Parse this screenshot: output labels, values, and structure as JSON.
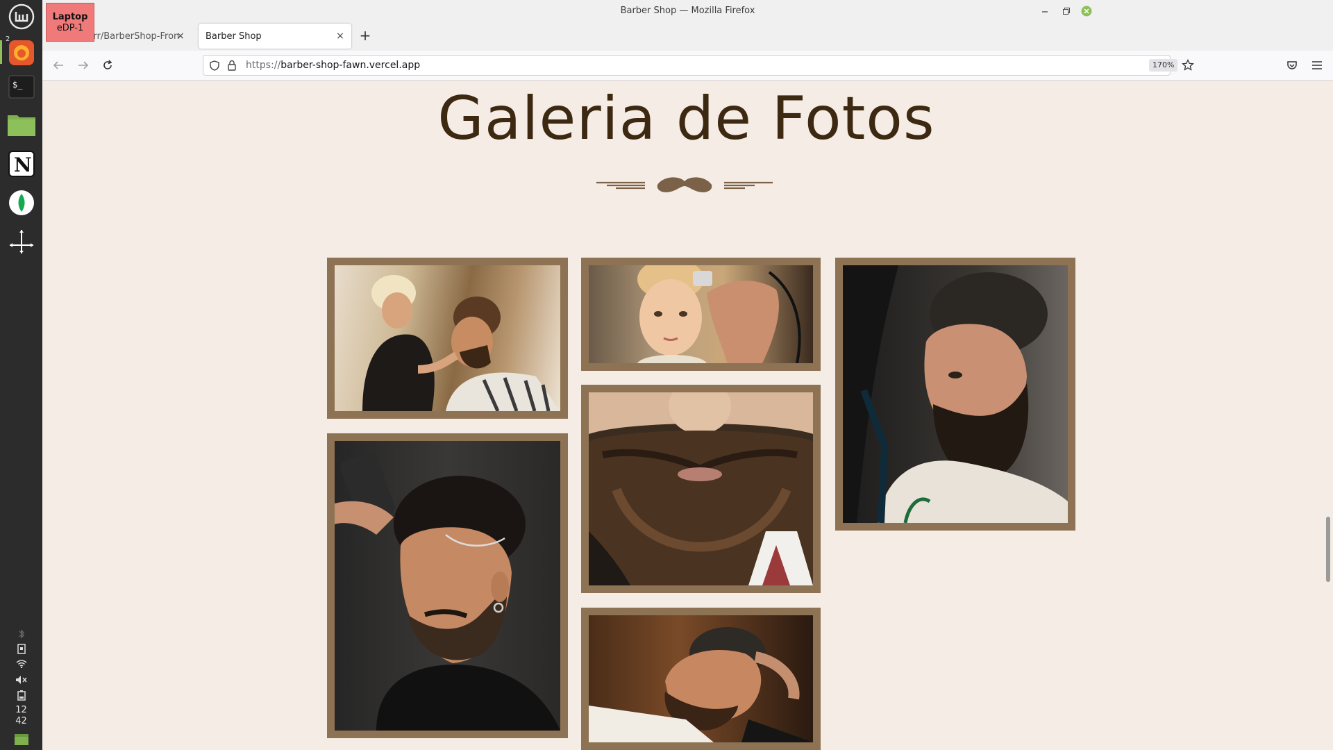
{
  "window": {
    "title": "Barber Shop — Mozilla Firefox"
  },
  "monitor_badge": {
    "line1": "Laptop",
    "line2": "eDP-1"
  },
  "dock": {
    "workspace_number": "2",
    "apps": [
      "mint-menu-icon",
      "firefox-icon",
      "terminal-icon",
      "files-icon",
      "notion-icon",
      "mongodb-compass-icon",
      "drawing-app-icon"
    ],
    "tray_icons": [
      "bluetooth-icon",
      "clipboard-icon",
      "wifi-icon",
      "volume-icon",
      "battery-icon",
      "desktop-icon"
    ],
    "clock": {
      "hours": "12",
      "minutes": "42"
    }
  },
  "tabs": [
    {
      "label": "walterrr/BarberShop-Front",
      "active": false
    },
    {
      "label": "Barber Shop",
      "active": true
    }
  ],
  "navbar": {
    "url_scheme": "https://",
    "url_host": "barber-shop-fawn.vercel.app",
    "zoom": "170%"
  },
  "page": {
    "gallery_title": "Galeria de Fotos",
    "photos": [
      "photo-woman-barber-styling-client",
      "photo-boy-haircut",
      "photo-bearded-man-profile",
      "photo-man-trimmer-fade",
      "photo-beard-closeup",
      "photo-man-hot-towel-shave"
    ]
  },
  "colors": {
    "page_background": "#f5ede5",
    "title_color": "#3d2912",
    "frame_color": "#8d7254",
    "mustache_color": "#7a6147"
  }
}
